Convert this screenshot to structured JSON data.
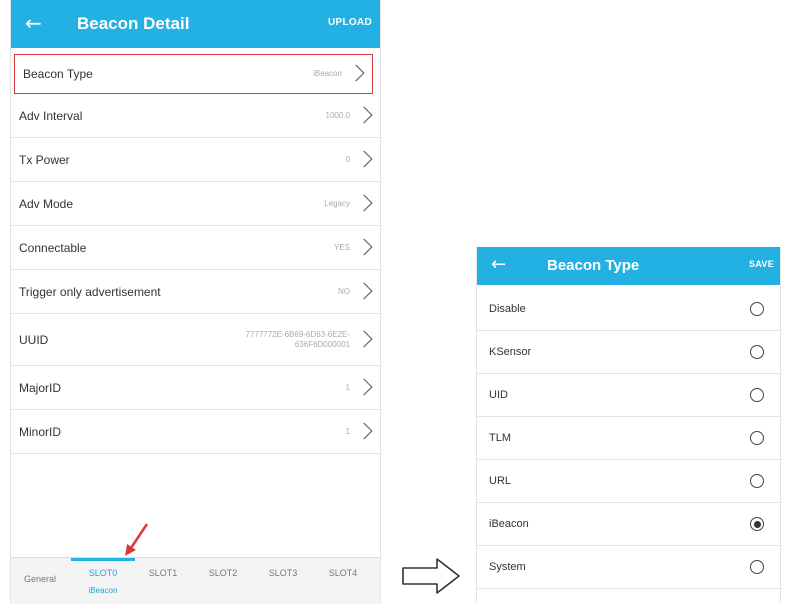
{
  "left_screen": {
    "appbar": {
      "back_icon": "←",
      "title": "Beacon Detail",
      "action": "UPLOAD"
    },
    "rows": [
      {
        "label": "Beacon Type",
        "value": "iBeacon",
        "highlighted": true
      },
      {
        "label": "Adv Interval",
        "value": "1000.0"
      },
      {
        "label": "Tx Power",
        "value": "0"
      },
      {
        "label": "Adv Mode",
        "value": "Legacy"
      },
      {
        "label": "Connectable",
        "value": "YES"
      },
      {
        "label": "Trigger only advertisement",
        "value": "NO"
      },
      {
        "label": "UUID",
        "value": "7777772E-6B69-6D63-6E2E-636F6D000001"
      },
      {
        "label": "MajorID",
        "value": "1"
      },
      {
        "label": "MinorID",
        "value": "1"
      }
    ],
    "tabs": {
      "general": "General",
      "slot0": "SLOT0",
      "slot0_sub": "iBeacon",
      "slot1": "SLOT1",
      "slot2": "SLOT2",
      "slot3": "SLOT3",
      "slot4": "SLOT4"
    },
    "accent_color": "#23b0e3",
    "highlight_color": "#d93b3b"
  },
  "right_screen": {
    "appbar": {
      "back_icon": "←",
      "title": "Beacon Type",
      "action": "SAVE"
    },
    "options": [
      {
        "label": "Disable",
        "checked": false
      },
      {
        "label": "KSensor",
        "checked": false
      },
      {
        "label": "UID",
        "checked": false
      },
      {
        "label": "TLM",
        "checked": false
      },
      {
        "label": "URL",
        "checked": false
      },
      {
        "label": "iBeacon",
        "checked": true
      },
      {
        "label": "System",
        "checked": false
      }
    ]
  }
}
